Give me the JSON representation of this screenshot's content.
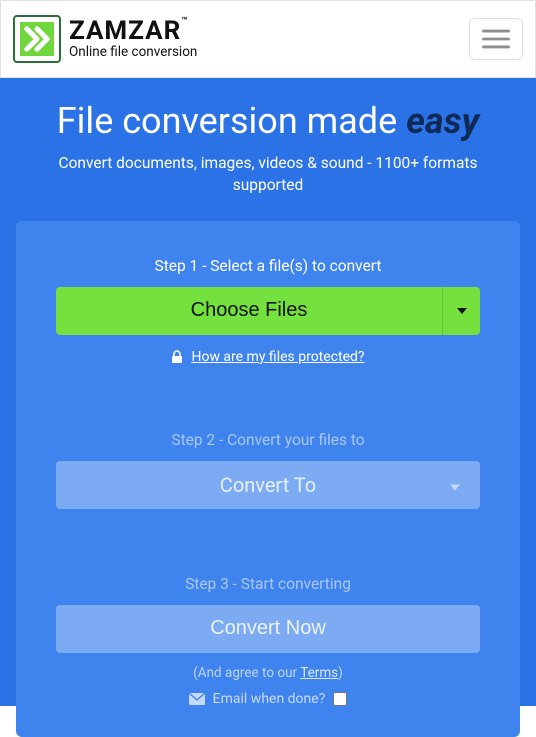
{
  "brand": {
    "name": "ZAMZAR",
    "tm": "™",
    "tagline": "Online file conversion"
  },
  "hero": {
    "headline_a": "File conversion made ",
    "headline_b": "easy",
    "sub": "Convert documents, images, videos & sound - 1100+ formats supported"
  },
  "step1": {
    "label": "Step 1 - Select a file(s) to convert",
    "choose": "Choose Files",
    "protect": "How are my files protected?"
  },
  "step2": {
    "label": "Step 2 - Convert your files to",
    "select": "Convert To"
  },
  "step3": {
    "label": "Step 3 - Start converting",
    "button": "Convert Now",
    "terms_pre": "(And agree to our ",
    "terms_link": "Terms",
    "terms_post": ")",
    "email": "Email when done?"
  }
}
